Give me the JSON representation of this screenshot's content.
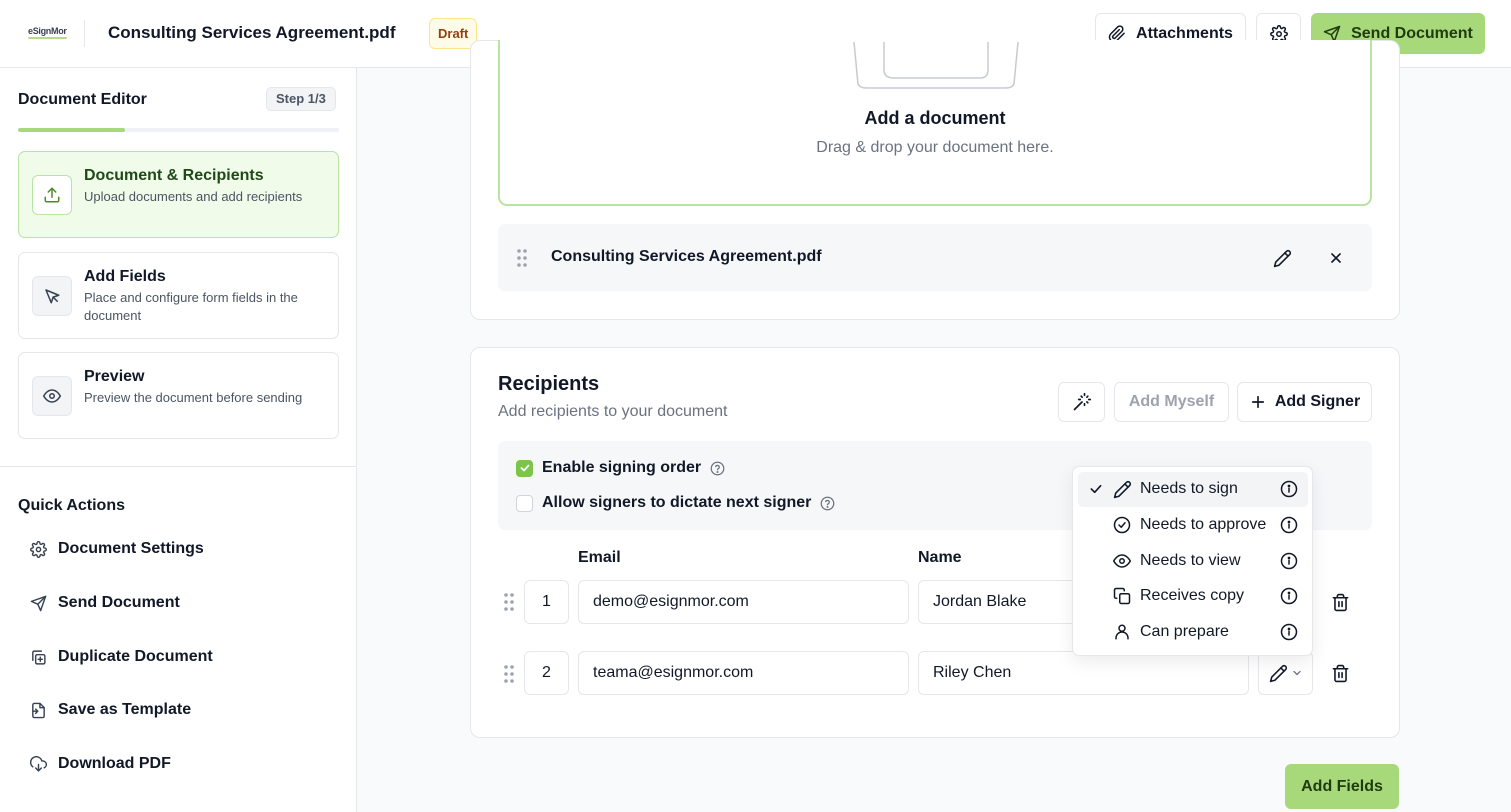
{
  "header": {
    "logo_text": "eSignMor",
    "document_title": "Consulting Services Agreement.pdf",
    "status_badge": "Draft",
    "attachments_label": "Attachments",
    "send_label": "Send Document"
  },
  "sidebar": {
    "title": "Document Editor",
    "step_badge": "Step 1/3",
    "progress_fraction": 0.333,
    "steps": [
      {
        "name": "Document & Recipients",
        "desc": "Upload documents and add recipients",
        "icon": "upload-icon",
        "active": true
      },
      {
        "name": "Add Fields",
        "desc": "Place and configure form fields in the document",
        "icon": "cursor-pointer-icon",
        "active": false
      },
      {
        "name": "Preview",
        "desc": "Preview the document before sending",
        "icon": "eye-icon",
        "active": false
      }
    ],
    "quick_actions_title": "Quick Actions",
    "quick_actions": [
      {
        "label": "Document Settings",
        "icon": "gear-icon"
      },
      {
        "label": "Send Document",
        "icon": "send-icon"
      },
      {
        "label": "Duplicate Document",
        "icon": "duplicate-icon"
      },
      {
        "label": "Save as Template",
        "icon": "template-icon"
      },
      {
        "label": "Download PDF",
        "icon": "download-icon"
      }
    ]
  },
  "document": {
    "drop_title": "Add a document",
    "drop_subtitle": "Drag & drop your document here.",
    "file_name": "Consulting Services Agreement.pdf"
  },
  "recipients": {
    "title": "Recipients",
    "subtitle": "Add recipients to your document",
    "add_myself_label": "Add Myself",
    "add_signer_label": "Add Signer",
    "enable_signing_order_label": "Enable signing order",
    "enable_signing_order_checked": true,
    "allow_dictate_label": "Allow signers to dictate next signer",
    "allow_dictate_checked": false,
    "email_column": "Email",
    "name_column": "Name",
    "rows": [
      {
        "order": "1",
        "email": "demo@esignmor.com",
        "name": "Jordan Blake"
      },
      {
        "order": "2",
        "email": "teama@esignmor.com",
        "name": "Riley Chen"
      }
    ]
  },
  "role_menu": {
    "items": [
      {
        "label": "Needs to sign",
        "icon": "pen-icon",
        "selected": true
      },
      {
        "label": "Needs to approve",
        "icon": "check-circle-icon",
        "selected": false
      },
      {
        "label": "Needs to view",
        "icon": "eye-icon",
        "selected": false
      },
      {
        "label": "Receives copy",
        "icon": "copy-icon",
        "selected": false
      },
      {
        "label": "Can prepare",
        "icon": "user-icon",
        "selected": false
      }
    ]
  },
  "footer": {
    "add_fields_label": "Add Fields"
  },
  "colors": {
    "accent": "#a7d97a",
    "accent_dark": "#7cc54b",
    "draft_bg": "#fefce8"
  }
}
